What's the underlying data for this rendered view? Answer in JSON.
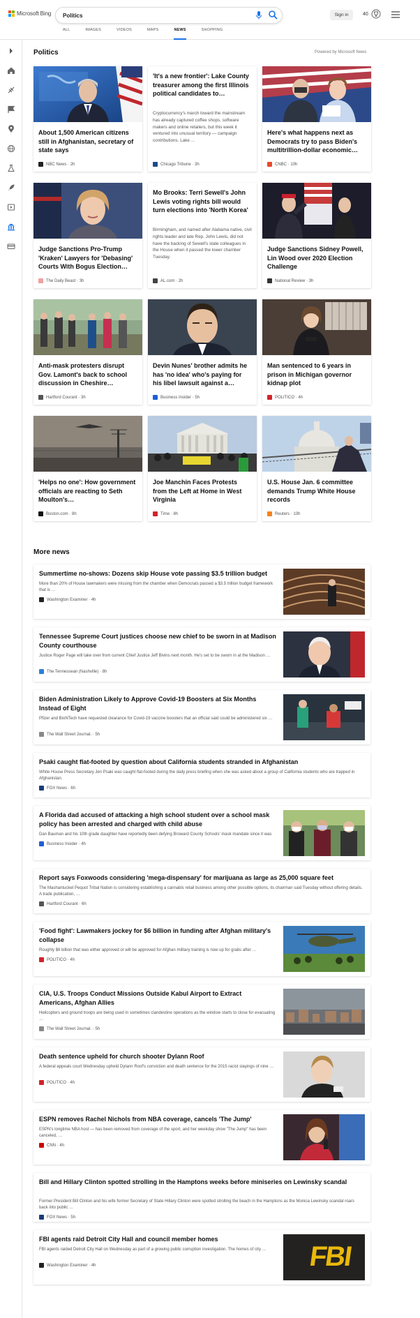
{
  "header": {
    "logo_text": "Microsoft Bing",
    "search_value": "Politics",
    "signin_label": "Sign in",
    "rewards_count": "40",
    "brand_colors": [
      "#f25022",
      "#7fba00",
      "#00a4ef",
      "#ffb900"
    ],
    "tabs": [
      "ALL",
      "IMAGES",
      "VIDEOS",
      "MAPS",
      "NEWS",
      "SHOPPING"
    ],
    "active_tab": "NEWS"
  },
  "rail": {
    "icons": [
      "chevron-right-icon",
      "home-icon",
      "sports-icon",
      "flag-icon",
      "location-pin-icon",
      "globe-icon",
      "science-icon",
      "rocket-icon",
      "entertainment-icon",
      "politics-icon",
      "money-icon"
    ]
  },
  "politics": {
    "title": "Politics",
    "powered_by": "Powered by Microsoft News",
    "cards": [
      {
        "title": "About 1,500 American citizens still in Afghanistan, secretary of state says",
        "source": "NBC News",
        "time": "2h",
        "source_color": "#222222",
        "image": "blinken"
      },
      {
        "title": "'It's a new frontier': Lake County treasurer among the first Illinois political candidates to…",
        "snippet": "Cryptocurrency's march toward the mainstream has already captured coffee shops, software makers and online retailers, but this week it ventured into unusual territory — campaign contributions. Lake …",
        "source": "Chicago Tribune",
        "time": "3h",
        "source_color": "#1a4b8c"
      },
      {
        "title": "Here's what happens next as Democrats try to pass Biden's multitrillion-dollar economic…",
        "source": "CNBC",
        "time": "10h",
        "source_color": "#e84a2a",
        "image": "pelosi"
      },
      {
        "title": "Judge Sanctions Pro-Trump 'Kraken' Lawyers for 'Debasing' Courts With Bogus Election…",
        "source": "The Daily Beast",
        "time": "3h",
        "source_color": "#f0a0a0",
        "image": "powell"
      },
      {
        "title": "Mo Brooks: Terri Sewell's John Lewis voting rights bill would turn elections into 'North Korea'",
        "snippet": "Birmingham, and named after Alabama native, civil rights leader and late Rep. John Lewis, did not have the backing of Sewell's state colleagues in the House when it passed the lower chamber Tuesday.",
        "source": "AL.com",
        "time": "2h",
        "source_color": "#444444"
      },
      {
        "title": "Judge Sanctions Sidney Powell, Lin Wood over 2020 Election Challenge",
        "source": "National Review",
        "time": "3h",
        "source_color": "#333333",
        "image": "rally"
      },
      {
        "title": "Anti-mask protesters disrupt Gov. Lamont's back to school discussion in Cheshire…",
        "source": "Hartford Courant",
        "time": "3h",
        "source_color": "#555555",
        "image": "protest"
      },
      {
        "title": "Devin Nunes' brother admits he has 'no idea' who's paying for his libel lawsuit against a…",
        "source": "Business Insider",
        "time": "5h",
        "source_color": "#1e5ed6",
        "image": "nunes"
      },
      {
        "title": "Man sentenced to 6 years in prison in Michigan governor kidnap plot",
        "source": "POLITICO",
        "time": "4h",
        "source_color": "#d2232a",
        "image": "whitmer"
      },
      {
        "title": "'Helps no one': How government officials are reacting to Seth Moulton's…",
        "source": "Boston.com",
        "time": "8h",
        "source_color": "#111111",
        "image": "airport"
      },
      {
        "title": "Joe Manchin Faces Protests from the Left at Home in West Virginia",
        "source": "Time",
        "time": "8h",
        "source_color": "#d2232a",
        "image": "court"
      },
      {
        "title": "U.S. House Jan. 6 committee demands Trump White House records",
        "source": "Reuters",
        "time": "10h",
        "source_color": "#f58220",
        "image": "capitol"
      }
    ]
  },
  "more_news": {
    "title": "More news",
    "items": [
      {
        "title": "Summertime no-shows: Dozens skip House vote passing $3.5 trillion budget",
        "snippet": "More than 20% of House lawmakers were missing from the chamber when Democrats passed a $3.5 trillion budget framework that is …",
        "source": "Washington Examiner",
        "time": "4h",
        "source_color": "#222222",
        "thumb": "chamber"
      },
      {
        "title": "Tennessee Supreme Court justices choose new chief to be sworn in at Madison County courthouse",
        "snippet": "Justice Roger Page will take over from current Chief Justice Jeff Bivins next month. He's set to be sworn in at the Madison …",
        "source": "The Tennessean (Nashville)",
        "time": "8h",
        "source_color": "#2f7ed8",
        "thumb": "justice"
      },
      {
        "title": "Biden Administration Likely to Approve Covid-19 Boosters at Six Months Instead of Eight",
        "snippet": "Pfizer and BioNTech have requested clearance for Covid-19 vaccine boosters that an official said could be administered six …",
        "source": "The Wall Street Journal.",
        "time": "5h",
        "source_color": "#888888",
        "thumb": "clinic"
      },
      {
        "title": "Psaki caught flat-footed by question about California students stranded in Afghanistan",
        "snippet": "White House Press Secretary Jen Psaki was caught flat-footed during the daily press briefing when she was asked about a group of California students who are trapped in Afghanistan.",
        "source": "FOX News",
        "time": "6h",
        "source_color": "#1a3c7a"
      },
      {
        "title": "A Florida dad accused of attacking a high school student over a school mask policy has been arrested and charged with child abuse",
        "snippet": "Dan Bauman and his 10th grade daughter have reportedly been defying Broward County Schools' mask mandate since it was …",
        "source": "Business Insider",
        "time": "4h",
        "source_color": "#1e5ed6",
        "thumb": "masks"
      },
      {
        "title": "Report says Foxwoods considering 'mega-dispensary' for marijuana as large as 25,000 square feet",
        "snippet": "The Mashantucket Pequot Tribal Nation is considering establishing a cannabis retail business among other possible options, its chairman said Tuesday without offering details. A trade publication, …",
        "source": "Hartford Courant",
        "time": "6h",
        "source_color": "#555555"
      },
      {
        "title": "'Food fight': Lawmakers jockey for $6 billion in funding after Afghan military's collapse",
        "snippet": "Roughly $6 billion that was either approved or will be approved for Afghan military training is now up for grabs after …",
        "source": "POLITICO",
        "time": "4h",
        "source_color": "#d2232a",
        "thumb": "helicopter"
      },
      {
        "title": "CIA, U.S. Troops Conduct Missions Outside Kabul Airport to Extract Americans, Afghan Allies",
        "snippet": "Helicopters and ground troops are being used in sometimes clandestine operations as the window starts to close for evacuating …",
        "source": "The Wall Street Journal.",
        "time": "5h",
        "source_color": "#888888",
        "thumb": "kabul"
      },
      {
        "title": "Death sentence upheld for church shooter Dylann Roof",
        "snippet": "A federal appeals court Wednesday upheld Dylann Roof's conviction and death sentence for the 2015 racist slayings of nine …",
        "source": "POLITICO",
        "time": "4h",
        "source_color": "#d2232a",
        "thumb": "roof"
      },
      {
        "title": "ESPN removes Rachel Nichols from NBA coverage, cancels 'The Jump'",
        "snippet": "ESPN's longtime NBA host — has been removed from coverage of the sport, and her weekday show \"The Jump\" has been canceled, …",
        "source": "CNN",
        "time": "4h",
        "source_color": "#cc0000",
        "thumb": "nichols"
      },
      {
        "title": "Bill and Hillary Clinton spotted strolling in the Hamptons weeks before miniseries on Lewinsky scandal",
        "snippet": "Former President Bill Clinton and his wife former Secretary of State Hillary Clinton were spotted strolling the beach in the Hamptons as the Monica Lewinsky scandal roars back into public …",
        "source": "FOX News",
        "time": "5h",
        "source_color": "#1a3c7a"
      },
      {
        "title": "FBI agents raid Detroit City Hall and council member homes",
        "snippet": "FBI agents raided Detroit City Hall on Wednesday as part of a growing public corruption investigation. The homes of city …",
        "source": "Washington Examiner",
        "time": "4h",
        "source_color": "#222222",
        "thumb": "fbi",
        "thumb_text": "FBI"
      }
    ]
  }
}
